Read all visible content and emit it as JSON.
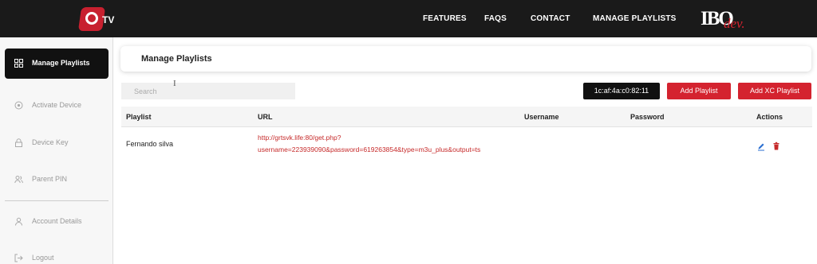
{
  "topbar": {
    "logo_text": "TV",
    "nav": [
      "FEATURES",
      "FAQS",
      "CONTACT",
      "MANAGE PLAYLISTS"
    ],
    "brand_main": "IBO",
    "brand_sub": "dev."
  },
  "sidebar": {
    "items": [
      {
        "label": "Manage Playlists",
        "icon": "grid-icon"
      },
      {
        "label": "Activate Device",
        "icon": "target-icon"
      },
      {
        "label": "Device Key",
        "icon": "lock-icon"
      },
      {
        "label": "Parent PIN",
        "icon": "users-icon"
      },
      {
        "label": "Account Details",
        "icon": "user-icon"
      },
      {
        "label": "Logout",
        "icon": "logout-icon"
      }
    ]
  },
  "main": {
    "title": "Manage Playlists",
    "search_placeholder": "Search",
    "mac_address": "1c:af:4a:c0:82:11",
    "add_playlist_label": "Add Playlist",
    "add_xc_label": "Add XC Playlist",
    "columns": [
      "Playlist",
      "URL",
      "Username",
      "Password",
      "Actions"
    ],
    "rows": [
      {
        "playlist": "Fernando silva",
        "url_line1": "http://grtsvk.life:80/get.php?",
        "url_line2": "username=223939090&password=619263854&type=m3u_plus&output=ts",
        "username": "",
        "password": ""
      }
    ]
  },
  "colors": {
    "accent_red": "#d4232f",
    "topbar_bg": "#1a1a1a",
    "url_red": "#c62a2a",
    "edit_blue": "#2b6fd1"
  }
}
